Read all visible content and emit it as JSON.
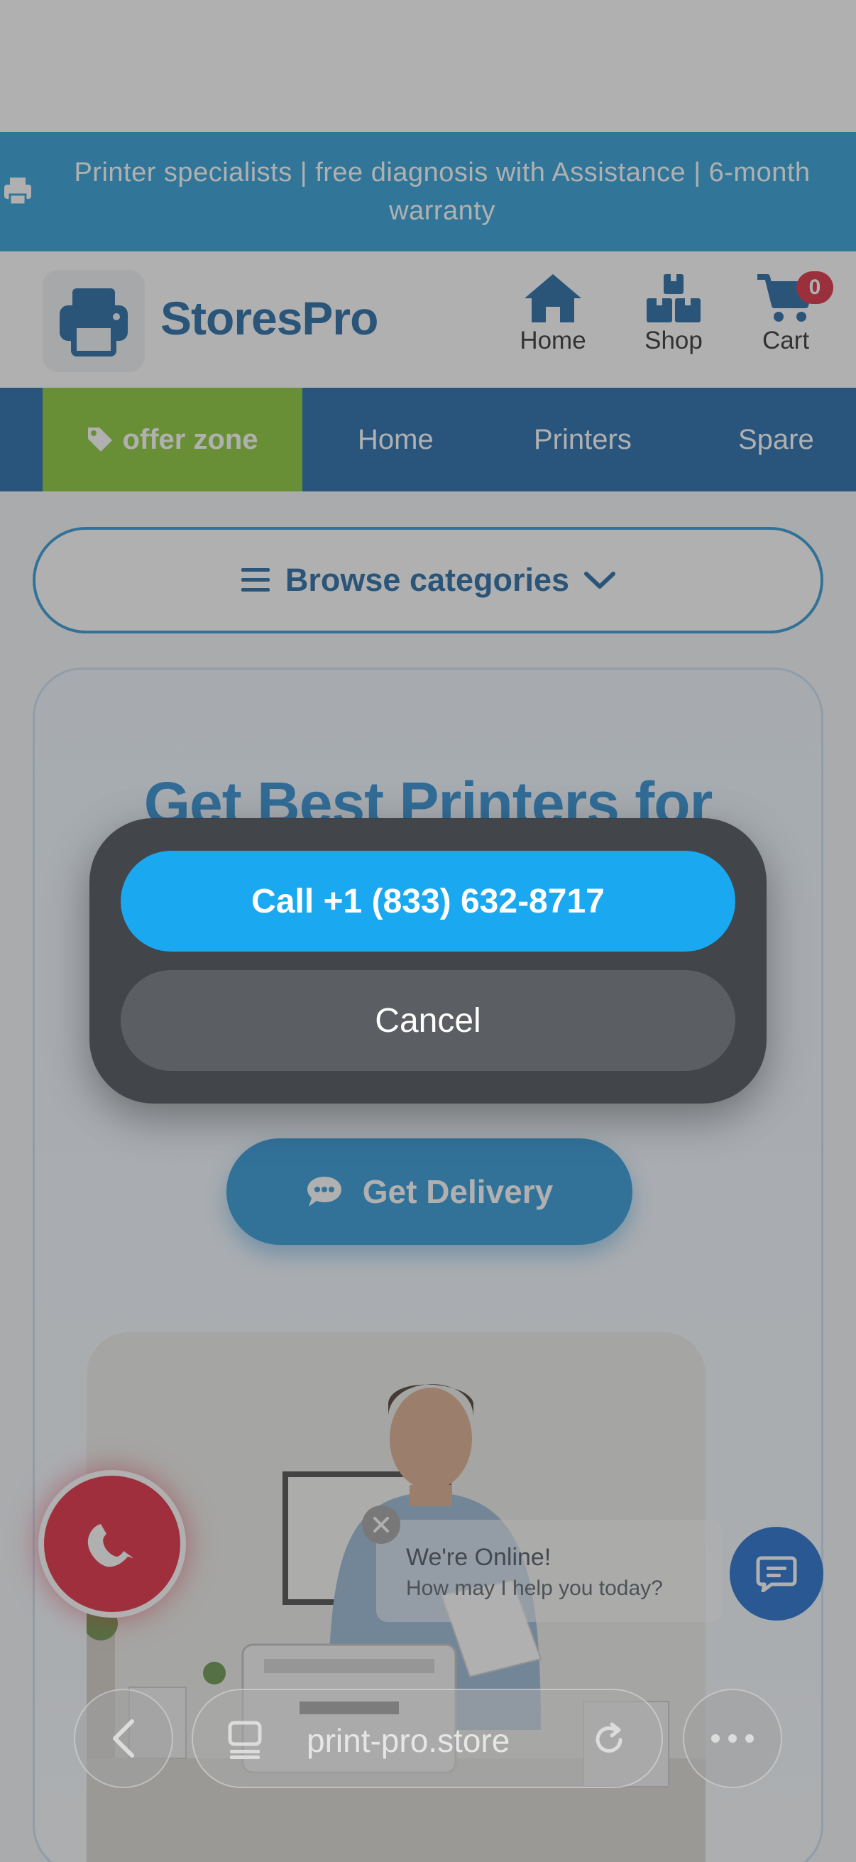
{
  "announcement": {
    "text": "Printer specialists | free diagnosis with Assistance | 6-month warranty"
  },
  "header": {
    "brand": "StoresPro",
    "nav": [
      {
        "label": "Home",
        "icon": "home-icon"
      },
      {
        "label": "Shop",
        "icon": "shop-icon"
      },
      {
        "label": "Cart",
        "icon": "cart-icon"
      }
    ],
    "cart_count": "0"
  },
  "menubar": {
    "offer_label": "offer zone",
    "items": [
      "Home",
      "Printers",
      "Spare"
    ]
  },
  "browse": {
    "label": "Browse categories"
  },
  "hero": {
    "title": "Get Best Printers for",
    "delivery_button": "Get Delivery"
  },
  "chat": {
    "line1": "We're Online!",
    "line2": "How may I help you today?"
  },
  "browser": {
    "url": "print-pro.store"
  },
  "action_sheet": {
    "call_label": "Call +1 (833) 632-8717",
    "cancel_label": "Cancel"
  },
  "colors": {
    "brand_blue": "#0b5a9c",
    "announce_blue": "#1996d6",
    "offer_green": "#7ec321",
    "call_red": "#e0142c",
    "sheet_call_blue": "#1aa8f0"
  }
}
